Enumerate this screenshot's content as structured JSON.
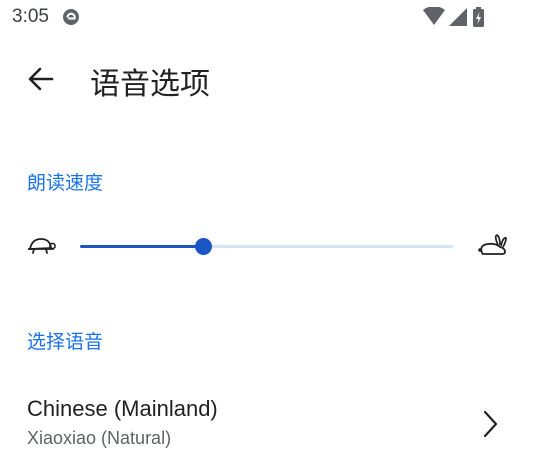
{
  "status_bar": {
    "time": "3:05",
    "icons": [
      "app-notification-icon",
      "wifi-icon",
      "cellular-signal-icon",
      "battery-charging-icon"
    ]
  },
  "app_bar": {
    "back_icon": "arrow-back-icon",
    "title": "语音选项"
  },
  "reading_speed": {
    "header": "朗读速度",
    "slow_icon": "turtle-icon",
    "fast_icon": "rabbit-icon",
    "value_fraction": 0.33
  },
  "voice_selection": {
    "header": "选择语音",
    "language": "Chinese (Mainland)",
    "voice": "Xiaoxiao (Natural)",
    "chevron_icon": "chevron-right-icon"
  },
  "colors": {
    "accent": "#1a73e8",
    "slider_active": "#1a56c4",
    "slider_inactive": "#d3e6f4",
    "primary_text": "#202124",
    "secondary_text": "#5f6368"
  }
}
